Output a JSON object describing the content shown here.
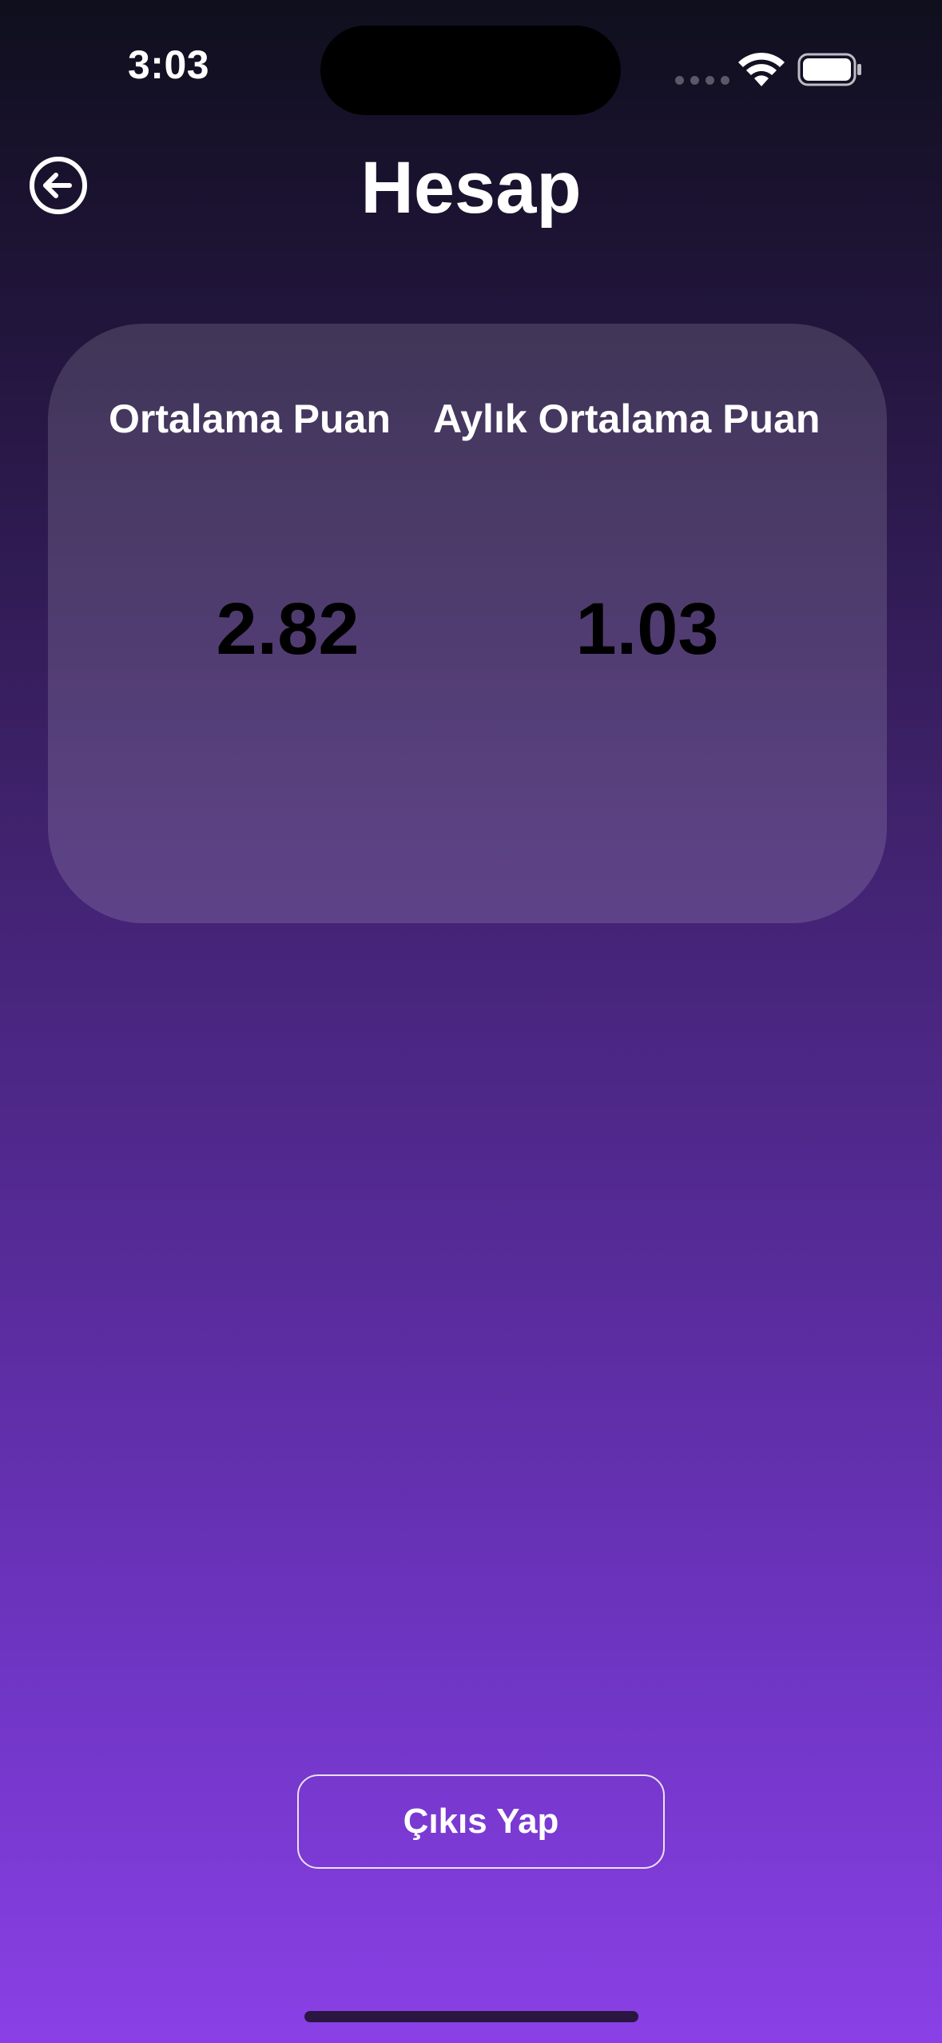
{
  "status_bar": {
    "time": "3:03"
  },
  "header": {
    "title": "Hesap",
    "back_icon": "arrow-left-circle-icon"
  },
  "stats": {
    "average_label": "Ortalama Puan",
    "average_value": "2.82",
    "monthly_label": "Aylık Ortalama Puan",
    "monthly_value": "1.03"
  },
  "actions": {
    "logout_label": "Çıkıs Yap"
  },
  "colors": {
    "gradient_top": "#0f0f1d",
    "gradient_bottom": "#8a40e6"
  }
}
